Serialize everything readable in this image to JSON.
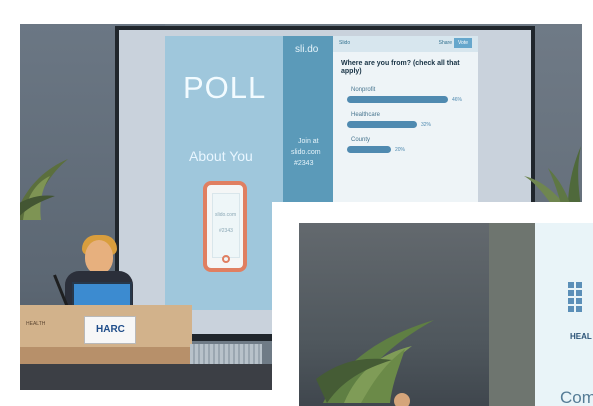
{
  "slide": {
    "title": "POLL",
    "subtitle": "About You",
    "phone_text_1": "slido.com",
    "phone_text_2": "#2343"
  },
  "slido": {
    "logo": "sli.do",
    "join_at": "Join at",
    "url": "slido.com",
    "code": "#2343"
  },
  "poll_panel": {
    "brand": "Slido",
    "share": "Share",
    "vote": "Vote",
    "question": "Where are you from? (check all that apply)",
    "options": [
      {
        "label": "Nonprofit",
        "percent": 46
      },
      {
        "label": "Healthcare",
        "percent": 32
      },
      {
        "label": "County",
        "percent": 20
      }
    ]
  },
  "podium": {
    "logo": "HARC",
    "small_text": "HEALTH"
  },
  "inset": {
    "slide_label": "HEAL",
    "caption_start": "Com"
  },
  "colors": {
    "slide_bg": "#a9cfe2",
    "slido_blue": "#5b9ab9",
    "phone_orange": "#e07f61"
  }
}
